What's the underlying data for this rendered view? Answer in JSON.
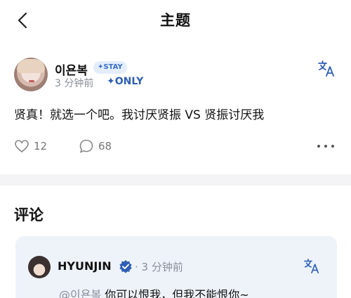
{
  "header": {
    "title": "主题"
  },
  "post": {
    "author": "이욘복",
    "badge": "✦STAY",
    "time": "3 分钟前",
    "tag": "✦ONLY",
    "text": "贤真！就选一个吧。我讨厌贤振 VS 贤振讨厌我",
    "likes": "12",
    "comments": "68"
  },
  "comments": {
    "heading": "评论",
    "items": [
      {
        "author": "HYUNJIN",
        "time": "· 3 分钟前",
        "mention": "@이욘복",
        "text": " 你可以恨我，但我不能恨你~"
      }
    ]
  },
  "colors": {
    "accent": "#2f5fb4",
    "badge_bg": "#e3edfb",
    "comment_bg": "#eef3fa"
  }
}
